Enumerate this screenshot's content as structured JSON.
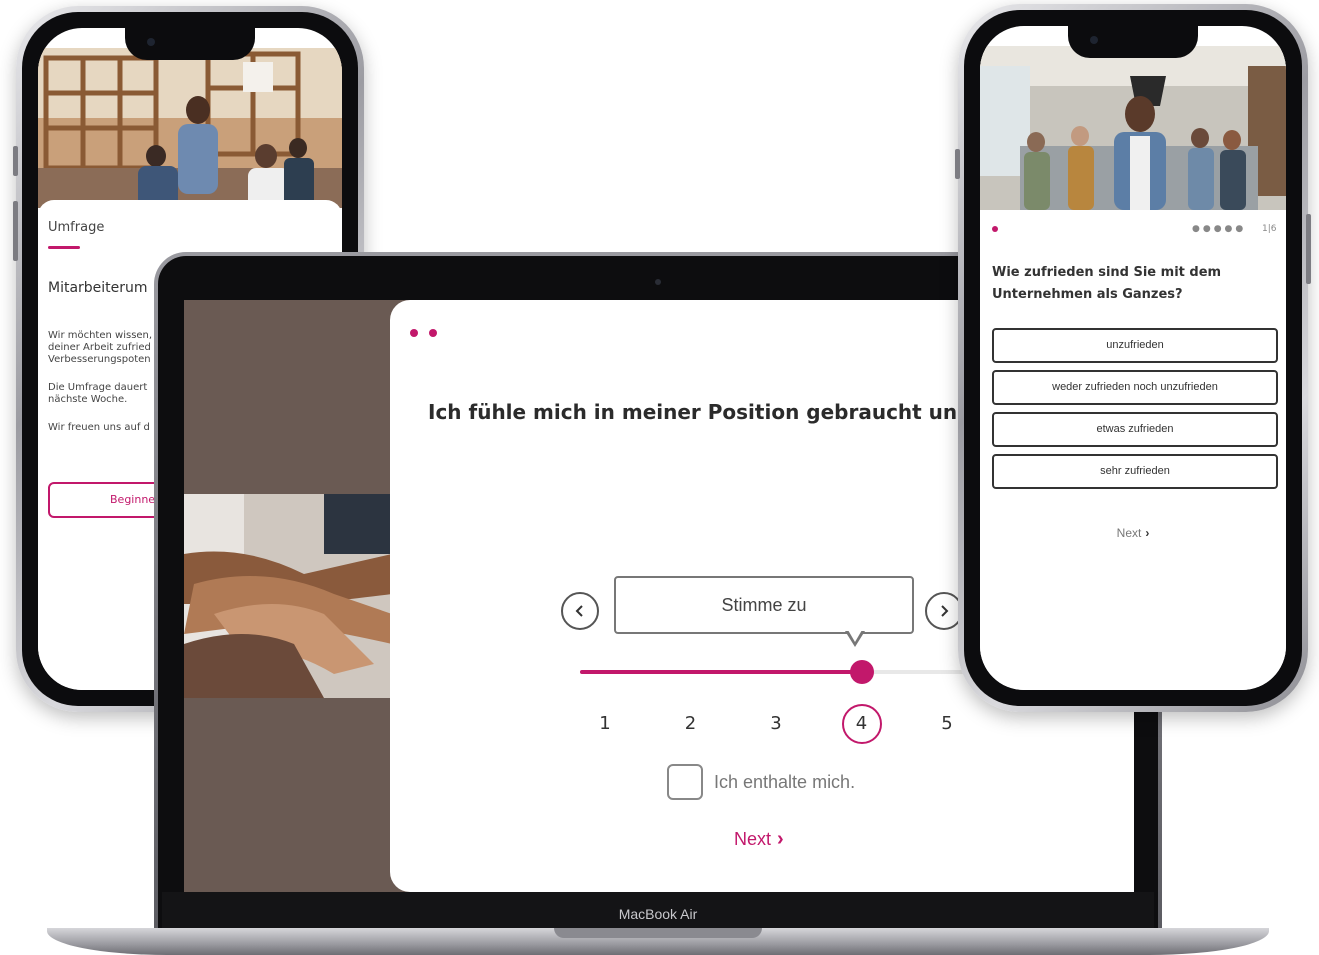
{
  "colors": {
    "accent": "#c2186b",
    "screen_bg": "#6a5a53",
    "text_dark": "#2b2b2b"
  },
  "left_phone": {
    "label": "Umfrage",
    "title": "Mitarbeiterum",
    "paragraph1": [
      "Wir möchten wissen,",
      "deiner Arbeit zufried",
      "Verbesserungspoten"
    ],
    "paragraph2": [
      "Die Umfrage dauert",
      "nächste Woche."
    ],
    "paragraph3": "Wir freuen uns auf d",
    "button_label": "Beginne j"
  },
  "laptop": {
    "brand": "MacBook Air",
    "question": "Ich fühle mich in meiner Position gebraucht und we",
    "prev_icon": "chevron-left-icon",
    "next_icon": "chevron-right-icon",
    "bubble_label": "Stimme zu",
    "scale": [
      "1",
      "2",
      "3",
      "4",
      "5"
    ],
    "selected_value": 4,
    "abstain_label": "Ich enthalte mich.",
    "next_label": "Next"
  },
  "right_phone": {
    "progress": "1|6",
    "question": [
      "Wie zufrieden sind Sie mit dem",
      "Unternehmen als Ganzes?"
    ],
    "options": [
      "unzufrieden",
      "weder zufrieden noch unzufrieden",
      "etwas zufrieden",
      "sehr zufrieden"
    ],
    "next_label": "Next"
  }
}
